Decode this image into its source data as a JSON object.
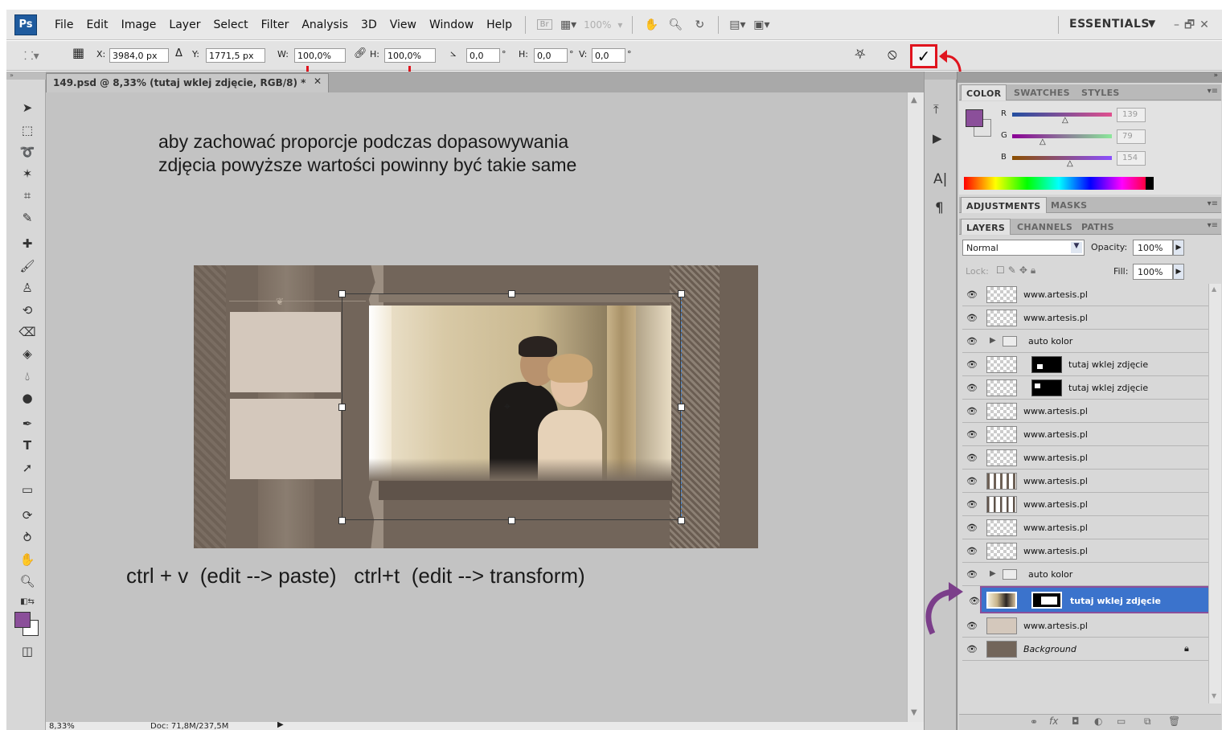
{
  "menubar": {
    "app_logo": "Ps",
    "items": [
      "File",
      "Edit",
      "Image",
      "Layer",
      "Select",
      "Filter",
      "Analysis",
      "3D",
      "View",
      "Window",
      "Help"
    ],
    "bridge_label": "Br",
    "zoom": "100%",
    "workspace": "ESSENTIALS"
  },
  "options": {
    "x_label": "X:",
    "x_value": "3984,0 px",
    "y_label": "Y:",
    "y_value": "1771,5 px",
    "w_label": "W:",
    "w_value": "100,0%",
    "h_label": "H:",
    "h_value": "100,0%",
    "angle_value": "0,0",
    "degree": "°",
    "hskew_label": "H:",
    "hskew_value": "0,0",
    "vskew_label": "V:",
    "vskew_value": "0,0"
  },
  "document": {
    "tab_title": "149.psd @ 8,33% (tutaj wklej zdjęcie, RGB/8) *",
    "annotation_top_1": "aby zachować proporcje podczas dopasowywania",
    "annotation_top_2": "zdjęcia powyższe wartości powinny być takie same",
    "annotation_bottom": "ctrl + v  (edit --> paste)   ctrl+t  (edit --> transform)",
    "status_zoom": "8,33%",
    "status_doc": "Doc: 71,8M/237,5M"
  },
  "color_panel": {
    "tabs": [
      "COLOR",
      "SWATCHES",
      "STYLES"
    ],
    "r_label": "R",
    "g_label": "G",
    "b_label": "B",
    "r_value": "139",
    "g_value": "79",
    "b_value": "154",
    "foreground_color": "#8B4F9A"
  },
  "adjustments_panel": {
    "tabs": [
      "ADJUSTMENTS",
      "MASKS"
    ]
  },
  "layers_panel": {
    "tabs": [
      "LAYERS",
      "CHANNELS",
      "PATHS"
    ],
    "blend_mode": "Normal",
    "opacity_label": "Opacity:",
    "opacity_value": "100%",
    "lock_label": "Lock:",
    "fill_label": "Fill:",
    "fill_value": "100%",
    "layers": [
      {
        "name": "www.artesis.pl",
        "kind": "layer"
      },
      {
        "name": "www.artesis.pl",
        "kind": "layer"
      },
      {
        "name": "auto kolor",
        "kind": "group"
      },
      {
        "name": "tutaj wklej zdjęcie",
        "kind": "masked"
      },
      {
        "name": "tutaj wklej zdjęcie",
        "kind": "masked"
      },
      {
        "name": "www.artesis.pl",
        "kind": "layer"
      },
      {
        "name": "www.artesis.pl",
        "kind": "layer"
      },
      {
        "name": "www.artesis.pl",
        "kind": "layer"
      },
      {
        "name": "www.artesis.pl",
        "kind": "layer"
      },
      {
        "name": "www.artesis.pl",
        "kind": "layer"
      },
      {
        "name": "www.artesis.pl",
        "kind": "layer"
      },
      {
        "name": "www.artesis.pl",
        "kind": "layer"
      },
      {
        "name": "auto kolor",
        "kind": "group"
      },
      {
        "name": "tutaj wklej zdjęcie",
        "kind": "selected"
      },
      {
        "name": "www.artesis.pl",
        "kind": "layer"
      },
      {
        "name": "Background",
        "kind": "background"
      }
    ]
  }
}
